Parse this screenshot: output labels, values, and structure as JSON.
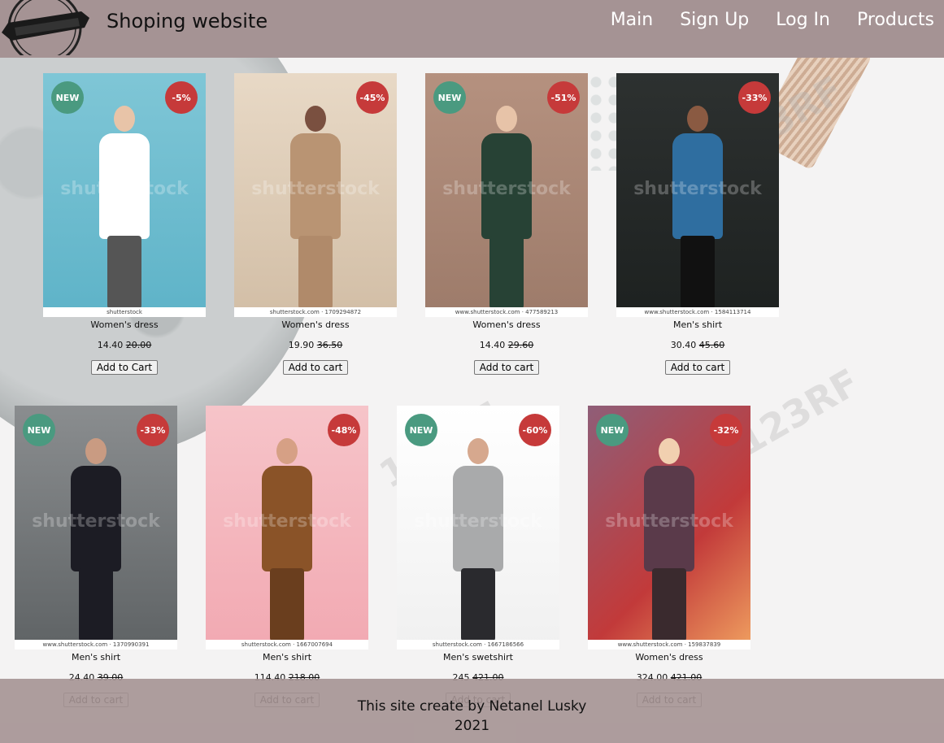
{
  "colors": {
    "header_bg": "#a59394",
    "nav_text": "#ffffff",
    "badge_new": "#4a9a80",
    "badge_discount": "#c63a3a",
    "footer_bg": "#a59394"
  },
  "header": {
    "title": "Shoping website",
    "logo_icon": "ribbon-logo-icon",
    "nav": [
      {
        "label": "Main"
      },
      {
        "label": "Sign Up"
      },
      {
        "label": "Log In"
      },
      {
        "label": "Products"
      }
    ]
  },
  "products": [
    {
      "name": "Women's dress",
      "price": "14.40",
      "old_price": "20.00",
      "new_label": "NEW",
      "discount": "-5%",
      "button": "Add to Cart",
      "strip": "shutterstock"
    },
    {
      "name": "Women's dress",
      "price": "19.90",
      "old_price": "36.50",
      "new_label": "",
      "discount": "-45%",
      "button": "Add to cart",
      "strip": "shutterstock.com · 1709294872"
    },
    {
      "name": "Women's dress",
      "price": "14.40",
      "old_price": "29.60",
      "new_label": "NEW",
      "discount": "-51%",
      "button": "Add to cart",
      "strip": "www.shutterstock.com · 477589213"
    },
    {
      "name": "Men's shirt",
      "price": "30.40",
      "old_price": "45.60",
      "new_label": "",
      "discount": "-33%",
      "button": "Add to cart",
      "strip": "www.shutterstock.com · 1584113714"
    },
    {
      "name": "Men's shirt",
      "price": "24.40",
      "old_price": "39.00",
      "new_label": "NEW",
      "discount": "-33%",
      "button": "Add to cart",
      "strip": "www.shutterstock.com · 1370990391"
    },
    {
      "name": "Men's shirt",
      "price": "114.40",
      "old_price": "218.00",
      "new_label": "",
      "discount": "-48%",
      "button": "Add to cart",
      "strip": "shutterstock.com · 1667007694"
    },
    {
      "name": "Men's swetshirt",
      "price": "245",
      "old_price": "421.00",
      "new_label": "NEW",
      "discount": "-60%",
      "button": "Add to cart",
      "strip": "shutterstock.com · 1667186566"
    },
    {
      "name": "Women's dress",
      "price": "324.00",
      "old_price": "421.00",
      "new_label": "NEW",
      "discount": "-32%",
      "button": "Add to cart",
      "strip": "www.shutterstock.com · 159837839"
    }
  ],
  "footer": {
    "line1": "This site create by Netanel Lusky",
    "line2": "2021"
  }
}
